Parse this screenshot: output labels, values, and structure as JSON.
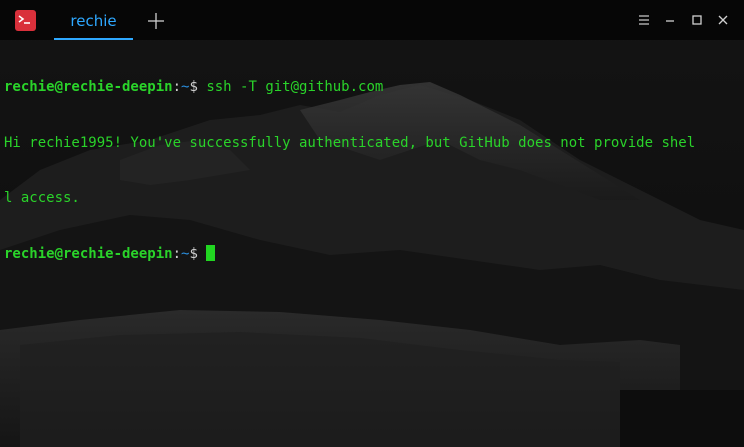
{
  "colors": {
    "accent": "#2ea8ff",
    "terminal_green": "#2ad32a",
    "path_blue": "#2a8fe0",
    "app_icon_red": "#d9303b"
  },
  "titlebar": {
    "app_icon": "terminal-app-icon",
    "tab_label": "rechie",
    "add_tab_icon": "plus-icon",
    "window_buttons": [
      "menu-icon",
      "minimize-icon",
      "maximize-icon",
      "close-icon"
    ]
  },
  "terminal": {
    "lines": [
      {
        "user_host": "rechie@rechie-deepin",
        "colon": ":",
        "path": "~",
        "dollar": "$ ",
        "command": "ssh -T git@github.com"
      },
      {
        "output": "Hi rechie1995! You've successfully authenticated, but GitHub does not provide shel"
      },
      {
        "output": "l access."
      },
      {
        "user_host": "rechie@rechie-deepin",
        "colon": ":",
        "path": "~",
        "dollar": "$ ",
        "command": ""
      }
    ]
  }
}
